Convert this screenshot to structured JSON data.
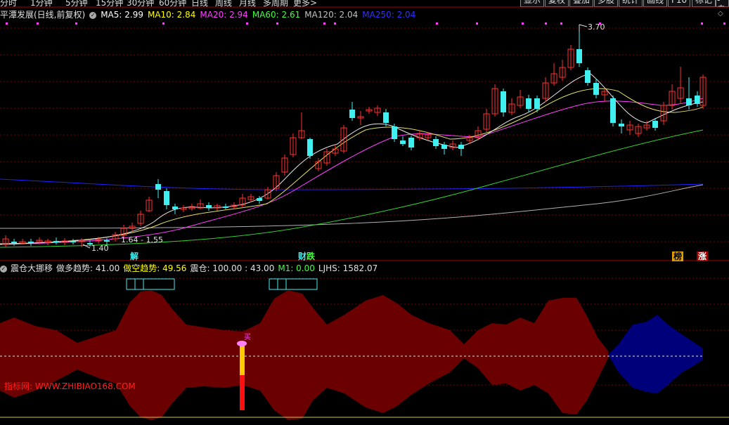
{
  "toolbar": {
    "items": [
      "分时",
      "1分钟",
      "5分钟",
      "15分钟",
      "30分钟",
      "60分钟",
      "日线",
      "周线",
      "月线",
      "多周期",
      "更多>"
    ],
    "right_buttons": [
      "显示",
      "复权",
      "叠加",
      "多股",
      "统计",
      "画线",
      "F10",
      "标记",
      "-自"
    ]
  },
  "main_legend": {
    "title": "平潭发展(日线,前复权)",
    "ma": [
      {
        "label": "MA5: 2.99",
        "color": "#ffffff"
      },
      {
        "label": "MA10: 2.84",
        "color": "#ffff00"
      },
      {
        "label": "MA20: 2.94",
        "color": "#ff40ff"
      },
      {
        "label": "MA60: 2.61",
        "color": "#40ff40"
      },
      {
        "label": "MA120: 2.04",
        "color": "#c0c0c0"
      },
      {
        "label": "MA250: 2.04",
        "color": "#3030ff"
      }
    ]
  },
  "price_annotations": {
    "high": "3.70",
    "low": "1.40",
    "range": "1.64 - 1.55"
  },
  "event_tags": {
    "jie": "解",
    "caizhang": "财",
    "die": "跌",
    "bang": "榜",
    "zhang": "涨"
  },
  "indicator_legend": {
    "name": "震仓大挪移",
    "items": [
      {
        "label": "做多趋势: 41.00",
        "color": "#e0e0e0"
      },
      {
        "label": "做空趋势: 49.56",
        "color": "#ffff00"
      },
      {
        "label": "震仓: 100.00 : 43.00",
        "color": "#e0e0e0"
      },
      {
        "label": "M1: 0.00",
        "color": "#40ff40"
      },
      {
        "label": "LJHS: 1582.07",
        "color": "#e0e0e0"
      }
    ]
  },
  "buy_signal": "买",
  "watermark": "指标网: WWW.ZHIBIAO168.COM",
  "colors": {
    "up": "#ff3030",
    "down": "#40f0f0",
    "grid": "#8b0000",
    "wave": "#6b0000",
    "wave_blue": "#00007a"
  },
  "chart_data": {
    "type": "candlestick",
    "price_high": 3.7,
    "price_low": 1.4
  }
}
